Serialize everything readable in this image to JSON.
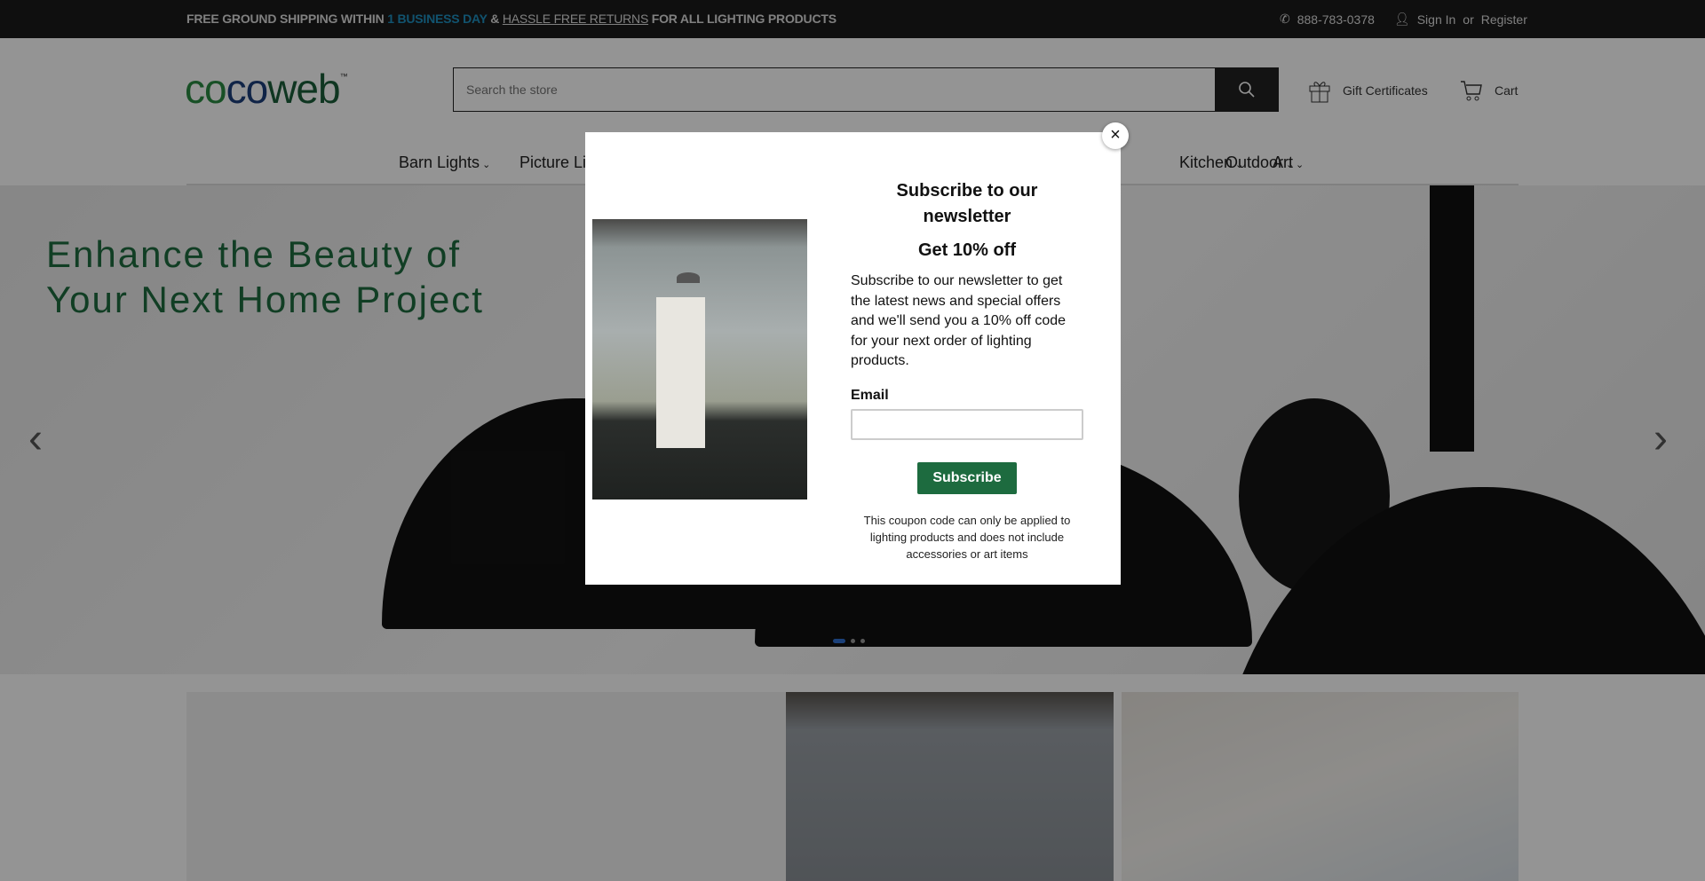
{
  "topbar": {
    "promo_a": "FREE GROUND SHIPPING WITHIN ",
    "promo_b": "1 BUSINESS DAY",
    "promo_c": " & ",
    "promo_d": "HASSLE FREE RETURNS",
    "promo_e": " FOR ALL LIGHTING PRODUCTS",
    "phone": "888-783-0378",
    "sign_in": "Sign In",
    "or": "or",
    "register": "Register"
  },
  "header": {
    "logo": {
      "c1": "co",
      "c2": "co",
      "c3": "web",
      "tm": "™"
    },
    "search_placeholder": "Search the store",
    "gift": "Gift Certificates",
    "cart": "Cart"
  },
  "nav": {
    "items": [
      "Barn Lights",
      "Picture Lights",
      "Outdoor",
      "Kitchen",
      "Art"
    ]
  },
  "hero": {
    "line1": "Enhance the Beauty of",
    "line2": "Your Next Home Project",
    "slides": 3,
    "active_slide": 1
  },
  "modal": {
    "title": "Subscribe to our newsletter",
    "subtitle": "Get 10% off",
    "body": "Subscribe to our newsletter to get the latest news and special offers and we'll send you a 10% off code for your next order of lighting products.",
    "email_label": "Email",
    "email_value": "",
    "button": "Subscribe",
    "fine_print": "This coupon code can only be applied to lighting products and does not include accessories or art items",
    "close": "×"
  },
  "colors": {
    "brand_green": "#1d6b3f",
    "accent_blue": "#1e8fbf",
    "topbar": "#1a1a1a"
  }
}
